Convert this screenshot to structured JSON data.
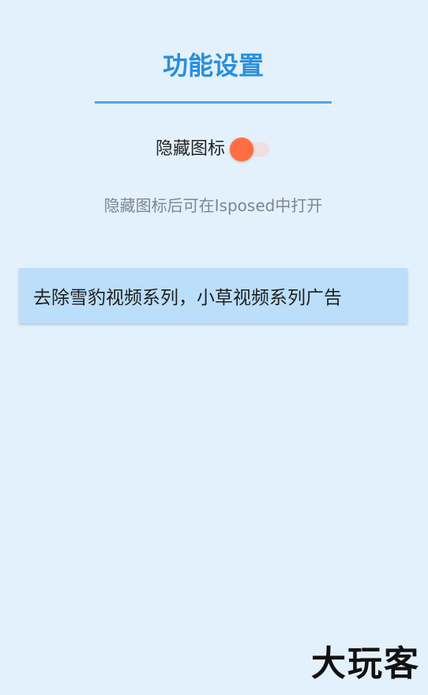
{
  "header": {
    "title": "功能设置"
  },
  "settings": {
    "hide_icon": {
      "label": "隐藏图标",
      "enabled": true
    },
    "hint": "隐藏图标后可在Isposed中打开"
  },
  "features": [
    {
      "label": "去除雪豹视频系列，小草视频系列广告"
    }
  ],
  "watermark": {
    "text": "大玩客"
  },
  "colors": {
    "background": "#E3F1FC",
    "title": "#2A8FDB",
    "divider": "#4AA8E8",
    "switch_thumb": "#FF6E40",
    "switch_track": "#F1DEDE",
    "card": "#BBDEFA"
  }
}
